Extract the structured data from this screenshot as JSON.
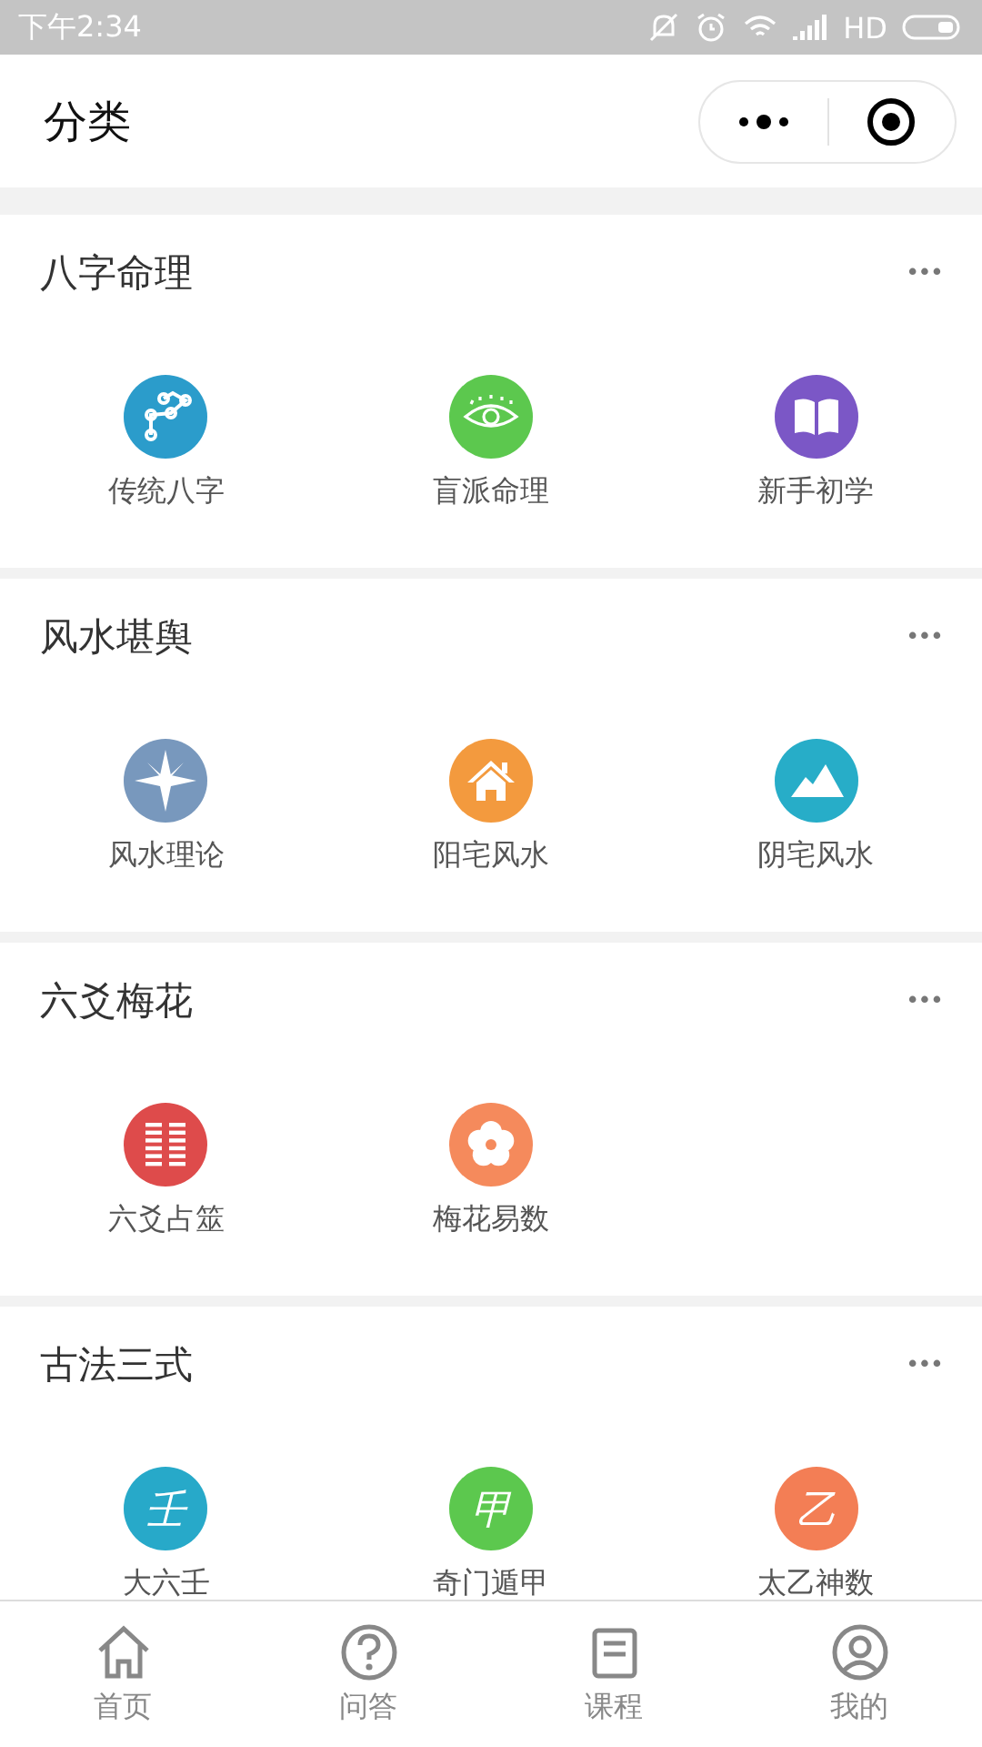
{
  "status_bar": {
    "time": "下午2:34",
    "network": "HD"
  },
  "header": {
    "title": "分类"
  },
  "sections": [
    {
      "title": "八字命理",
      "more": "•••",
      "items": [
        {
          "label": "传统八字",
          "kind": "path",
          "color": "#2b9ccb"
        },
        {
          "label": "盲派命理",
          "kind": "eye",
          "color": "#5cc84e"
        },
        {
          "label": "新手初学",
          "kind": "book",
          "color": "#7b57c6"
        }
      ]
    },
    {
      "title": "风水堪舆",
      "more": "•••",
      "items": [
        {
          "label": "风水理论",
          "kind": "compass",
          "color": "#7898bd"
        },
        {
          "label": "阳宅风水",
          "kind": "house",
          "color": "#f39a3e"
        },
        {
          "label": "阴宅风水",
          "kind": "mountain",
          "color": "#27adc8"
        }
      ]
    },
    {
      "title": "六爻梅花",
      "more": "•••",
      "items": [
        {
          "label": "六爻占筮",
          "kind": "hexagram",
          "color": "#de4b4b"
        },
        {
          "label": "梅花易数",
          "kind": "flower",
          "color": "#f58a5c"
        }
      ]
    },
    {
      "title": "古法三式",
      "more": "•••",
      "items": [
        {
          "label": "大六壬",
          "kind": "glyph",
          "glyph": "壬",
          "color": "#27a9c9"
        },
        {
          "label": "奇门遁甲",
          "kind": "glyph",
          "glyph": "甲",
          "color": "#5cc84e"
        },
        {
          "label": "太乙神数",
          "kind": "glyph",
          "glyph": "乙",
          "color": "#f37e55"
        }
      ]
    }
  ],
  "tab_bar": [
    {
      "label": "首页",
      "kind": "home",
      "selected": false
    },
    {
      "label": "问答",
      "kind": "question",
      "selected": false
    },
    {
      "label": "课程",
      "kind": "course",
      "selected": false
    },
    {
      "label": "我的",
      "kind": "profile",
      "selected": false
    }
  ]
}
